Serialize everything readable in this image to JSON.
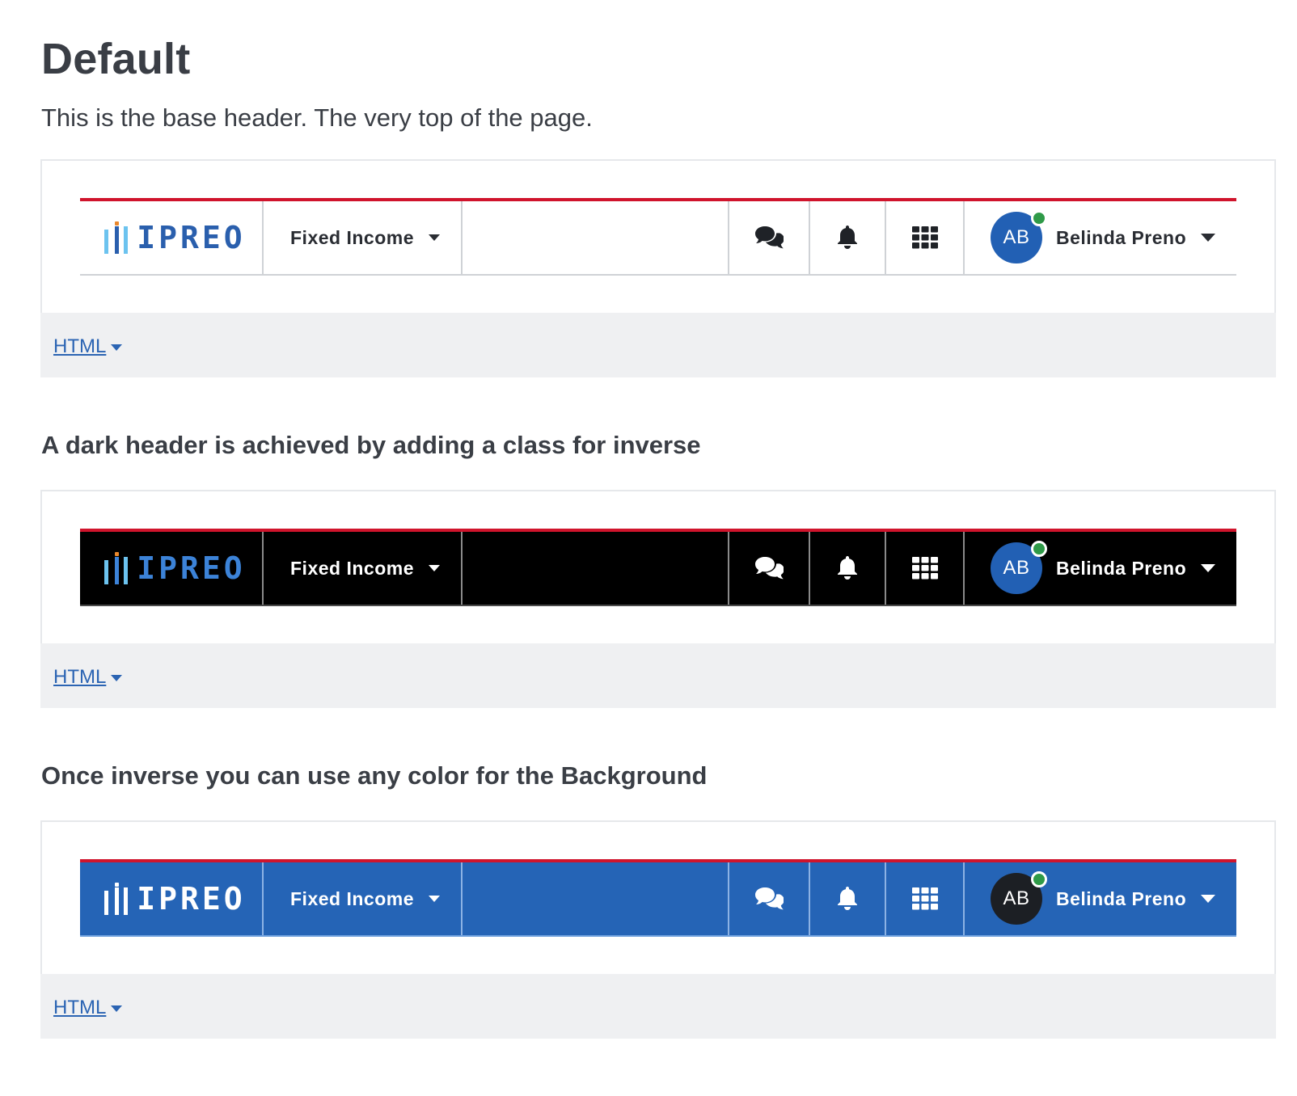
{
  "page": {
    "title": "Default",
    "description": "This is the base header. The very top of the page."
  },
  "sections": {
    "dark_heading": "A dark header is achieved by adding a class for inverse",
    "color_heading": "Once inverse you can use any color for the Background"
  },
  "header": {
    "logo_text": "IPREO",
    "module_label": "Fixed Income",
    "icons": [
      "chat-icon",
      "bell-icon",
      "apps-grid-icon",
      "chevron-down-icon"
    ],
    "user": {
      "initials": "AB",
      "name": "Belinda Preno",
      "presence": "online"
    }
  },
  "footer": {
    "toggle_label": "HTML"
  },
  "colors": {
    "accent_red": "#d0142c",
    "brand_blue": "#2564b6",
    "dark_bg": "#000000",
    "presence_green": "#2f9a48",
    "link_blue": "#2b64b3"
  }
}
